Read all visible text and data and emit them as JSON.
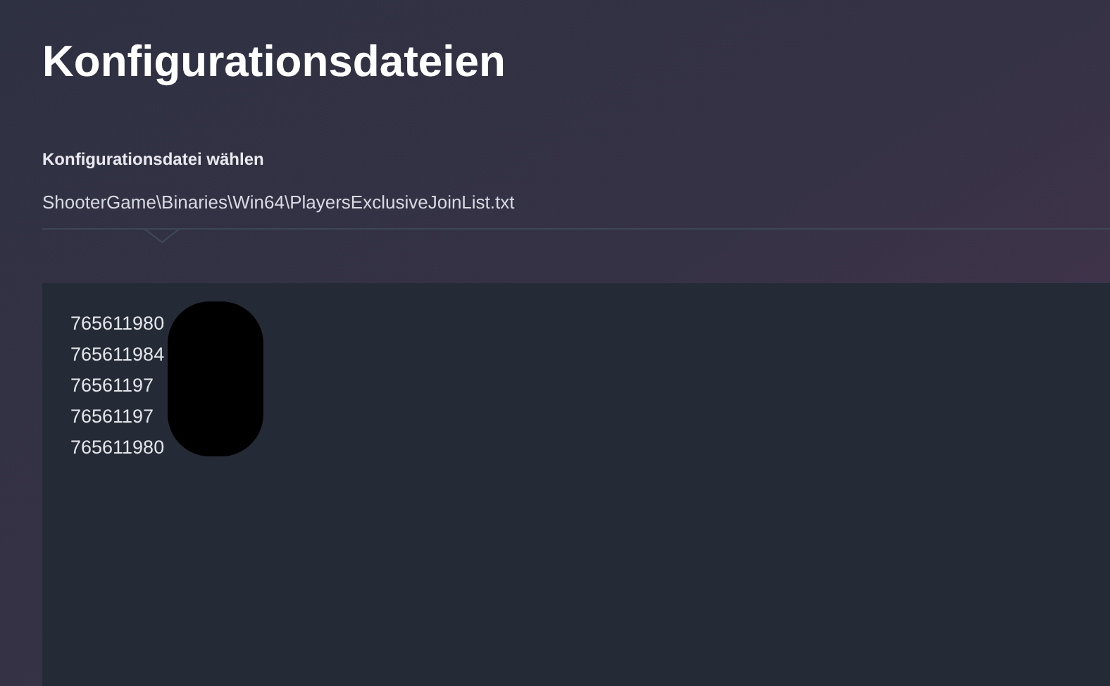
{
  "title": "Konfigurationsdateien",
  "file_select": {
    "label": "Konfigurationsdatei wählen",
    "value": "ShooterGame\\Binaries\\Win64\\PlayersExclusiveJoinList.txt"
  },
  "editor": {
    "lines": [
      "765611980",
      "765611984",
      "76561197",
      "76561197",
      "765611980"
    ]
  }
}
